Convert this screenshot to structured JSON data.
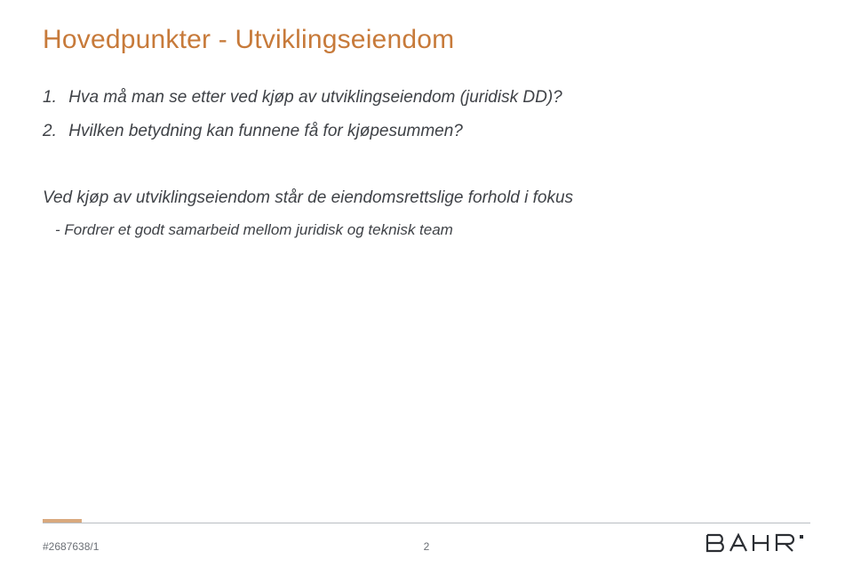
{
  "title": "Hovedpunkter - Utviklingseiendom",
  "items": [
    {
      "num": "1.",
      "text": "Hva må man se etter ved kjøp av utviklingseiendom (juridisk DD)?"
    },
    {
      "num": "2.",
      "text": "Hvilken betydning kan funnene få for kjøpesummen?"
    }
  ],
  "emphasis": "Ved kjøp av utviklingseiendom står de eiendomsrettslige forhold i fokus",
  "bullet": "Fordrer et godt samarbeid mellom juridisk og teknisk team",
  "footer": {
    "docnum": "#2687638/1",
    "page": "2",
    "logo_text": "BAHR"
  },
  "colors": {
    "accent": "#c77a3a",
    "accent_bar": "#d9a97e",
    "body": "#3f4247"
  }
}
